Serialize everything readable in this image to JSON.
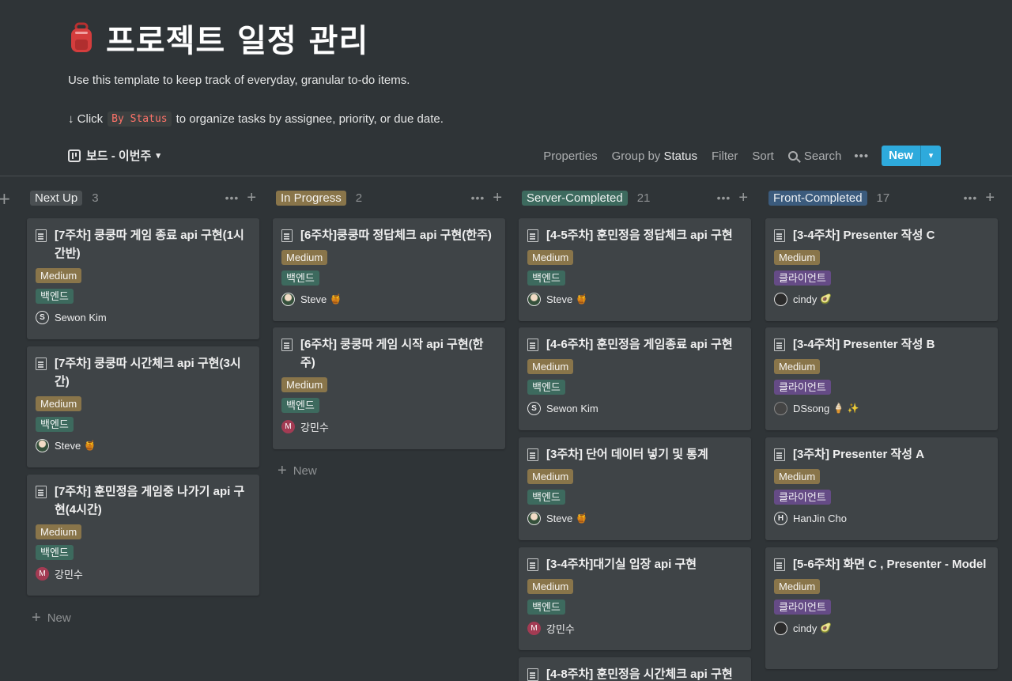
{
  "page": {
    "title": "프로젝트 일정 관리",
    "title_icon": "backpack-icon",
    "description": "Use this template to keep track of everyday, granular to-do items.",
    "hint_prefix": "↓ Click",
    "hint_code": "By Status",
    "hint_suffix": "to organize tasks by assignee, priority, or due date."
  },
  "view": {
    "name": "보드 - 이번주",
    "properties": "Properties",
    "group_by": "Group by",
    "group_by_value": "Status",
    "filter": "Filter",
    "sort": "Sort",
    "search": "Search",
    "more": "•••",
    "new": "New"
  },
  "columns": [
    {
      "name": "Next Up",
      "count": "3",
      "color": "#4a4f52",
      "cards": [
        {
          "title": "[7주차] 쿵쿵따 게임 종료 api 구현(1시간반)",
          "priority": "Medium",
          "tag": "백엔드",
          "assignee": "Sewon Kim",
          "emoji": ""
        },
        {
          "title": "[7주차] 쿵쿵따 시간체크 api 구현(3시간)",
          "priority": "Medium",
          "tag": "백엔드",
          "assignee": "Steve",
          "emoji": "🍯"
        },
        {
          "title": "[7주차] 훈민정음 게임중 나가기 api 구현(4시간)",
          "priority": "Medium",
          "tag": "백엔드",
          "assignee": "강민수",
          "emoji": ""
        }
      ],
      "new_label": "New"
    },
    {
      "name": "In Progress",
      "count": "2",
      "color": "#89754a",
      "cards": [
        {
          "title": "[6주차]쿵쿵따 정답체크 api 구현(한주)",
          "priority": "Medium",
          "tag": "백엔드",
          "assignee": "Steve",
          "emoji": "🍯"
        },
        {
          "title": "[6주차] 쿵쿵따 게임 시작 api 구현(한주)",
          "priority": "Medium",
          "tag": "백엔드",
          "assignee": "강민수",
          "emoji": ""
        }
      ],
      "new_label": "New"
    },
    {
      "name": "Server-Completed",
      "count": "21",
      "color": "#3d6a5e",
      "cards": [
        {
          "title": "[4-5주차] 훈민정음 정답체크 api 구현",
          "priority": "Medium",
          "tag": "백엔드",
          "assignee": "Steve",
          "emoji": "🍯"
        },
        {
          "title": "[4-6주차] 훈민정음 게임종료 api 구현",
          "priority": "Medium",
          "tag": "백엔드",
          "assignee": "Sewon Kim",
          "emoji": ""
        },
        {
          "title": "[3주차] 단어 데이터 넣기 및 통계",
          "priority": "Medium",
          "tag": "백엔드",
          "assignee": "Steve",
          "emoji": "🍯"
        },
        {
          "title": "[3-4주차]대기실 입장 api 구현",
          "priority": "Medium",
          "tag": "백엔드",
          "assignee": "강민수",
          "emoji": ""
        },
        {
          "title": "[4-8주차] 훈민정음 시간체크 api 구현",
          "priority": "",
          "tag": "",
          "assignee": "",
          "emoji": ""
        }
      ]
    },
    {
      "name": "Front-Completed",
      "count": "17",
      "color": "#3b5b7d",
      "cards": [
        {
          "title": "[3-4주차] Presenter 작성 C",
          "priority": "Medium",
          "tag": "클라이언트",
          "assignee": "cindy",
          "emoji": "🥑"
        },
        {
          "title": "[3-4주차] Presenter 작성 B",
          "priority": "Medium",
          "tag": "클라이언트",
          "assignee": "DSsong",
          "emoji": "🍦 ✨"
        },
        {
          "title": "[3주차] Presenter 작성 A",
          "priority": "Medium",
          "tag": "클라이언트",
          "assignee": "HanJin Cho",
          "emoji": ""
        },
        {
          "title": "[5-6주차] 화면 C , Presenter - Model",
          "priority": "Medium",
          "tag": "클라이언트",
          "assignee": "cindy",
          "emoji": "🥑"
        }
      ]
    }
  ]
}
